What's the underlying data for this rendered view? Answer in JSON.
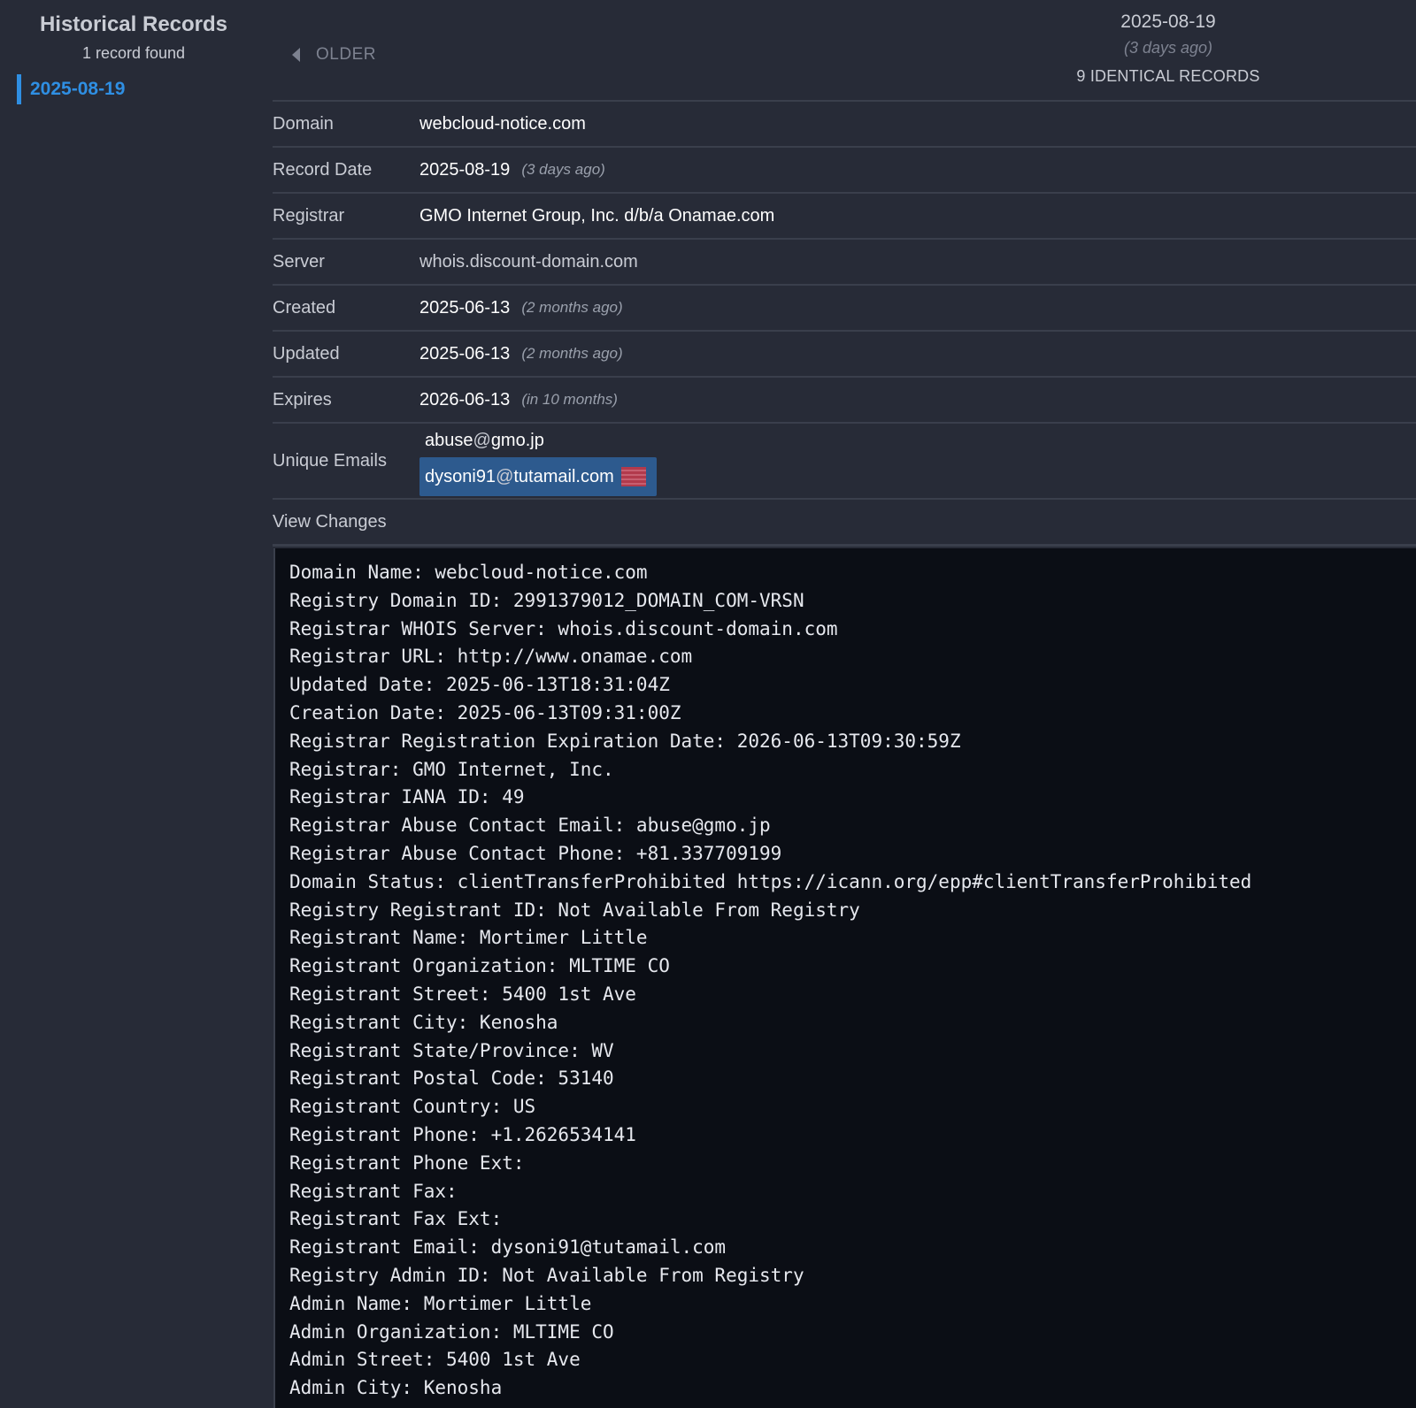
{
  "sidebar": {
    "title": "Historical Records",
    "count": "1 record found",
    "dates": [
      "2025-08-19"
    ]
  },
  "nav": {
    "older_label": "OLDER"
  },
  "record_header": {
    "date": "2025-08-19",
    "relative": "(3 days ago)",
    "identical": "9 IDENTICAL RECORDS"
  },
  "fields": {
    "domain": {
      "label": "Domain",
      "value": "webcloud-notice.com"
    },
    "record_date": {
      "label": "Record Date",
      "value": "2025-08-19",
      "relative": "(3 days ago)"
    },
    "registrar": {
      "label": "Registrar",
      "value": "GMO Internet Group, Inc. d/b/a Onamae.com"
    },
    "server": {
      "label": "Server",
      "value": "whois.discount-domain.com"
    },
    "created": {
      "label": "Created",
      "value": "2025-06-13",
      "relative": "(2 months ago)"
    },
    "updated": {
      "label": "Updated",
      "value": "2025-06-13",
      "relative": "(2 months ago)"
    },
    "expires": {
      "label": "Expires",
      "value": "2026-06-13",
      "relative": "(in 10 months)"
    }
  },
  "emails": {
    "label": "Unique Emails",
    "items": [
      {
        "user": "abuse",
        "at": "@",
        "domain": "gmo.jp"
      },
      {
        "user": "dysoni91",
        "at": "@",
        "domain": "tutamail.com",
        "flag_icon": "us-flag-icon"
      }
    ]
  },
  "view_changes_label": "View Changes",
  "raw_whois": [
    "Domain Name: webcloud-notice.com",
    "Registry Domain ID: 2991379012_DOMAIN_COM-VRSN",
    "Registrar WHOIS Server: whois.discount-domain.com",
    "Registrar URL: http://www.onamae.com",
    "Updated Date: 2025-06-13T18:31:04Z",
    "Creation Date: 2025-06-13T09:31:00Z",
    "Registrar Registration Expiration Date: 2026-06-13T09:30:59Z",
    "Registrar: GMO Internet, Inc.",
    "Registrar IANA ID: 49",
    "Registrar Abuse Contact Email: abuse@gmo.jp",
    "Registrar Abuse Contact Phone: +81.337709199",
    "Domain Status: clientTransferProhibited https://icann.org/epp#clientTransferProhibited",
    "Registry Registrant ID: Not Available From Registry",
    "Registrant Name: Mortimer Little",
    "Registrant Organization: MLTIME CO",
    "Registrant Street: 5400 1st Ave",
    "Registrant City: Kenosha",
    "Registrant State/Province: WV",
    "Registrant Postal Code: 53140",
    "Registrant Country: US",
    "Registrant Phone: +1.2626534141",
    "Registrant Phone Ext:",
    "Registrant Fax:",
    "Registrant Fax Ext:",
    "Registrant Email: dysoni91@tutamail.com",
    "Registry Admin ID: Not Available From Registry",
    "Admin Name: Mortimer Little",
    "Admin Organization: MLTIME CO",
    "Admin Street: 5400 1st Ave",
    "Admin City: Kenosha"
  ],
  "colors": {
    "background": "#272b37",
    "accent": "#2f8fe3",
    "highlight": "#2d5a8e",
    "terminal_bg": "#0b0e15"
  }
}
